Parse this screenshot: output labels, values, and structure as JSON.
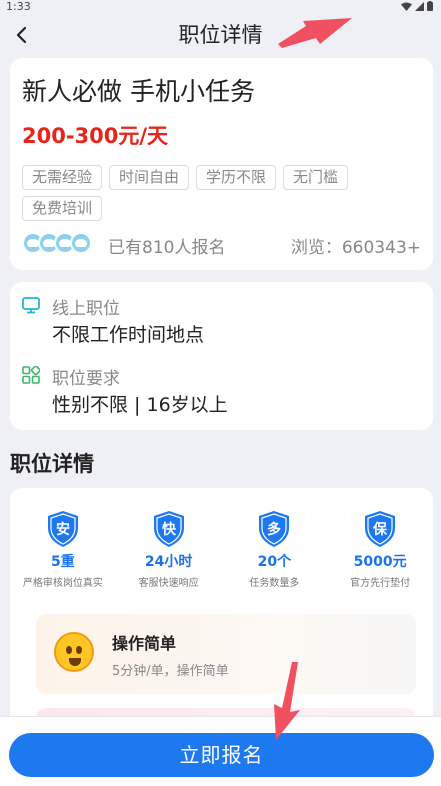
{
  "status_bar": {
    "time": "1:33"
  },
  "nav": {
    "title": "职位详情"
  },
  "job": {
    "title": "新人必做 手机小任务",
    "salary": "200-300元/天",
    "tags": [
      "无需经验",
      "时间自由",
      "学历不限",
      "无门槛",
      "免费培训"
    ],
    "signup_text": "已有810人报名",
    "views_text": "浏览：660343+"
  },
  "info": {
    "location_label": "线上职位",
    "location_value": "不限工作时间地点",
    "requirement_label": "职位要求",
    "requirement_value": "性别不限 | 16岁以上"
  },
  "details": {
    "section_title": "职位详情",
    "features": [
      {
        "icon_char": "安",
        "value": "5重",
        "desc": "严格审核岗位真实"
      },
      {
        "icon_char": "快",
        "value": "24小时",
        "desc": "客服快速响应"
      },
      {
        "icon_char": "多",
        "value": "20个",
        "desc": "任务数量多"
      },
      {
        "icon_char": "保",
        "value": "5000元",
        "desc": "官方先行垫付"
      }
    ],
    "feature_card": {
      "title": "操作简单",
      "desc": "5分钟/单，操作简单"
    }
  },
  "apply_button": {
    "label": "立即报名"
  },
  "colors": {
    "accent": "#1e78f0",
    "salary": "#e8251b",
    "annotation": "#f0505f"
  }
}
